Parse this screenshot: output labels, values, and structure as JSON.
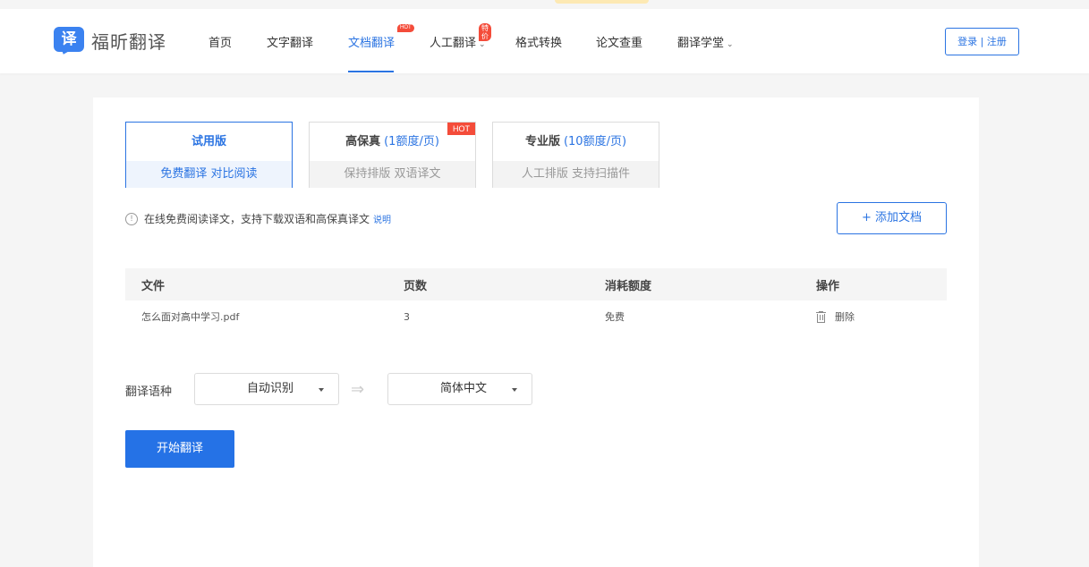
{
  "brand": {
    "logo_glyph": "译",
    "name": "福昕翻译",
    "color": "#3b82f0"
  },
  "nav": {
    "items": [
      {
        "label": "首页"
      },
      {
        "label": "文字翻译"
      },
      {
        "label": "文档翻译",
        "active": true,
        "badge": "HOT"
      },
      {
        "label": "人工翻译",
        "badge": "特价",
        "has_dropdown": true
      },
      {
        "label": "格式转换"
      },
      {
        "label": "论文查重"
      },
      {
        "label": "翻译学堂",
        "has_dropdown": true
      }
    ],
    "login_label": "登录 | 注册"
  },
  "plans": [
    {
      "title": "试用版",
      "note": "",
      "sub": "免费翻译  对比阅读",
      "selected": true
    },
    {
      "title": "高保真",
      "note": "(1额度/页)",
      "sub": "保持排版  双语译文",
      "badge": "HOT"
    },
    {
      "title": "专业版",
      "note": "(10额度/页)",
      "sub": "人工排版  支持扫描件"
    }
  ],
  "info": {
    "icon": "!",
    "text": "在线免费阅读译文，支持下载双语和高保真译文",
    "link": "说明"
  },
  "add_document_label": "+ 添加文档",
  "table": {
    "headers": [
      "文件",
      "页数",
      "消耗额度",
      "操作"
    ],
    "rows": [
      {
        "file": "怎么面对高中学习.pdf",
        "pages": "3",
        "cost": "免费",
        "action": "删除"
      }
    ]
  },
  "language": {
    "label": "翻译语种",
    "source": "自动识别",
    "arrow": "⇒",
    "target": "简体中文"
  },
  "start_label": "开始翻译",
  "colors": {
    "accent": "#2b74e2",
    "hot": "#f44c3a",
    "primary_button": "#2572e6"
  }
}
